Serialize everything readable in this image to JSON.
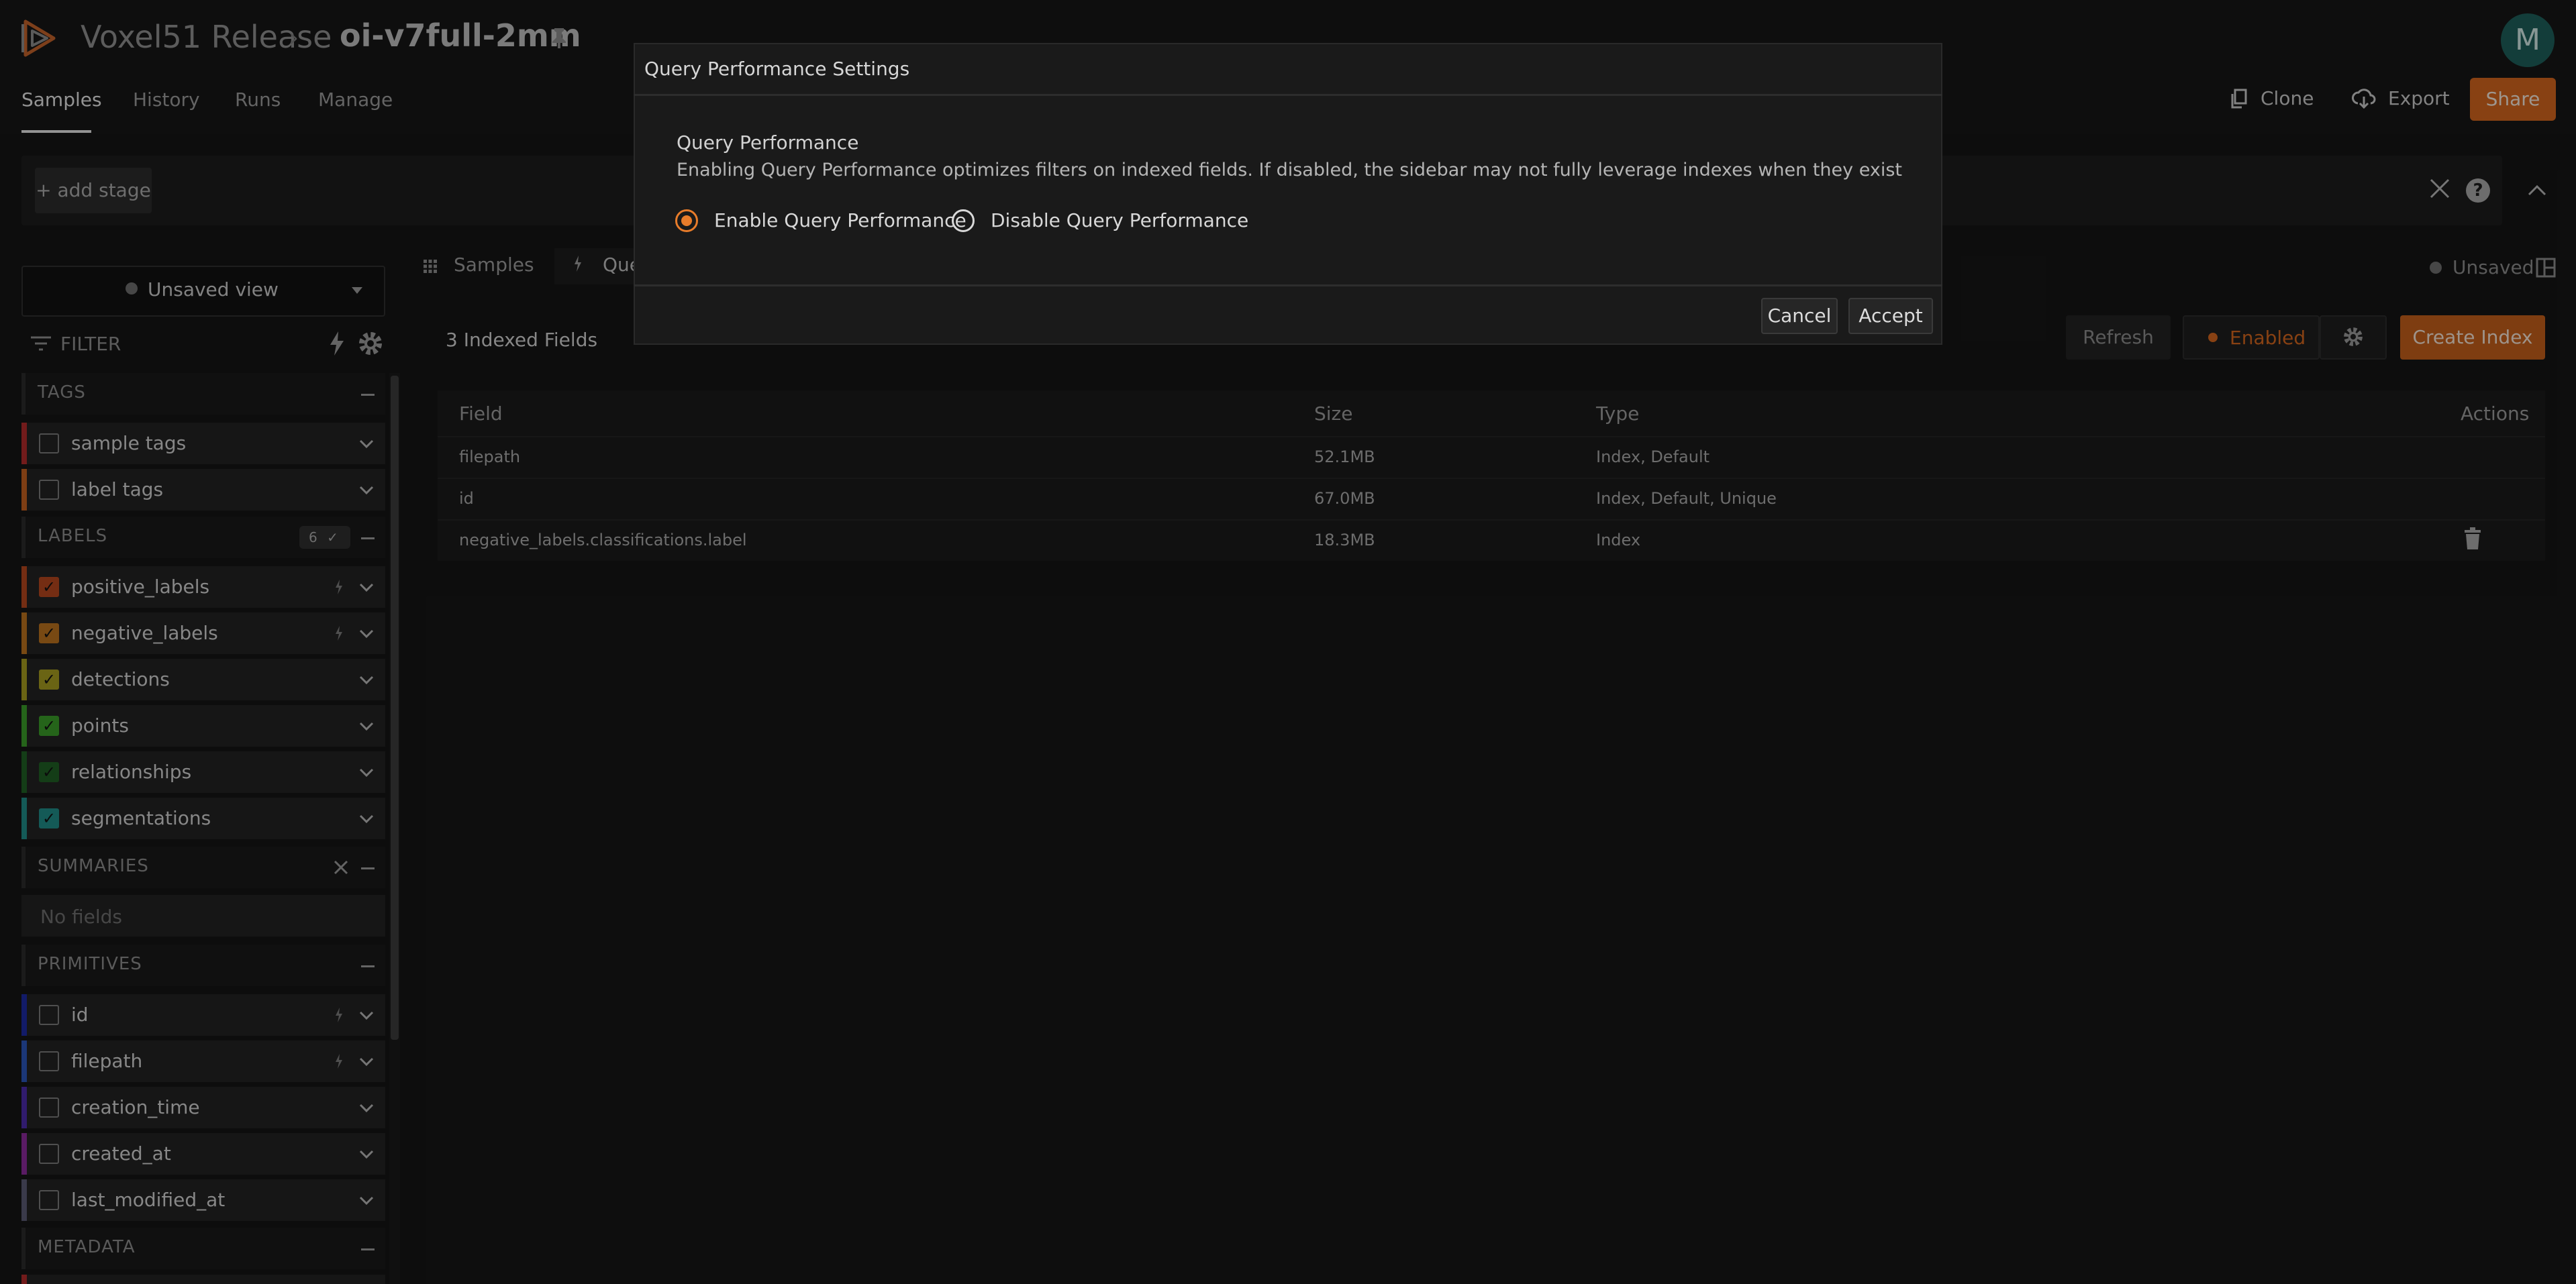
{
  "header": {
    "app_title": "Voxel51 Release",
    "breadcrumb_sep": "›",
    "dataset_name": "oi-v7full-2mm",
    "avatar_letter": "M",
    "tabs": [
      "Samples",
      "History",
      "Runs",
      "Manage"
    ],
    "clone_label": "Clone",
    "export_label": "Export",
    "share_label": "Share"
  },
  "viewbar": {
    "add_stage_label": "+ add stage",
    "help_label": "?"
  },
  "sidebar": {
    "view_label": "Unsaved view",
    "filter_label": "FILTER",
    "sections": {
      "tags": "TAGS",
      "labels": "LABELS",
      "labels_count": "6",
      "summaries": "SUMMARIES",
      "primitives": "PRIMITIVES",
      "metadata": "METADATA"
    },
    "tag_items": [
      "sample tags",
      "label tags"
    ],
    "label_items": [
      "positive_labels",
      "negative_labels",
      "detections",
      "points",
      "relationships",
      "segmentations"
    ],
    "no_fields": "No fields",
    "primitive_items": [
      "id",
      "filepath",
      "creation_time",
      "created_at",
      "last_modified_at"
    ]
  },
  "main": {
    "tab_samples": "Samples",
    "tab_qp": "Query Performance",
    "unsaved_label": "Unsaved",
    "indexed_count": "3 Indexed Fields",
    "refresh_label": "Refresh",
    "enabled_label": "Enabled",
    "create_index_label": "Create Index",
    "table": {
      "headers": [
        "Field",
        "Size",
        "Type",
        "Actions"
      ],
      "rows": [
        {
          "field": "filepath",
          "size": "52.1MB",
          "type": "Index, Default"
        },
        {
          "field": "id",
          "size": "67.0MB",
          "type": "Index, Default, Unique"
        },
        {
          "field": "negative_labels.classifications.label",
          "size": "18.3MB",
          "type": "Index"
        }
      ]
    }
  },
  "modal": {
    "title": "Query Performance Settings",
    "heading": "Query Performance",
    "description": "Enabling Query Performance optimizes filters on indexed fields. If disabled, the sidebar may not fully leverage indexes when they exist",
    "option_enable": "Enable Query Performance",
    "option_disable": "Disable Query Performance",
    "selected_option": "enable",
    "cancel_label": "Cancel",
    "accept_label": "Accept"
  },
  "colors": {
    "accent": "#d1651e",
    "positive_labels": "#b3461e",
    "negative_labels": "#b8701e",
    "detections": "#a39a1f",
    "points": "#3a9a28",
    "relationships": "#1f5e24",
    "segmentations": "#1f8a86"
  }
}
